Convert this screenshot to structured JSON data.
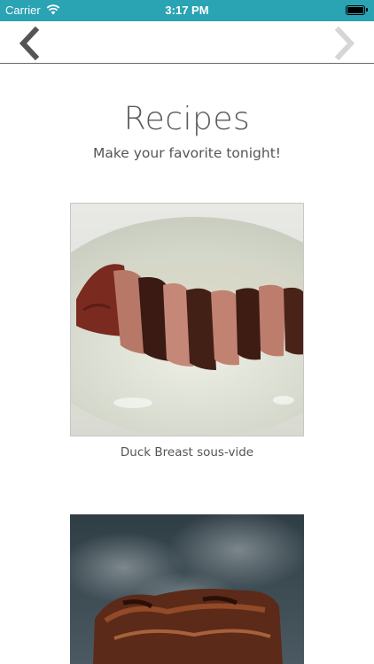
{
  "status_bar": {
    "carrier": "Carrier",
    "time": "3:17 PM",
    "bg_color": "#2aa3b3"
  },
  "nav": {
    "back_icon": "chevron-left-icon",
    "forward_icon": "chevron-right-icon",
    "forward_enabled": false
  },
  "header": {
    "title": "Recipes",
    "subtitle": "Make your favorite tonight!"
  },
  "recipes": [
    {
      "name": "Duck Breast sous-vide",
      "image": "sliced-duck-breast-photo"
    },
    {
      "name": "",
      "image": "grilled-meat-with-smoke-photo"
    }
  ]
}
